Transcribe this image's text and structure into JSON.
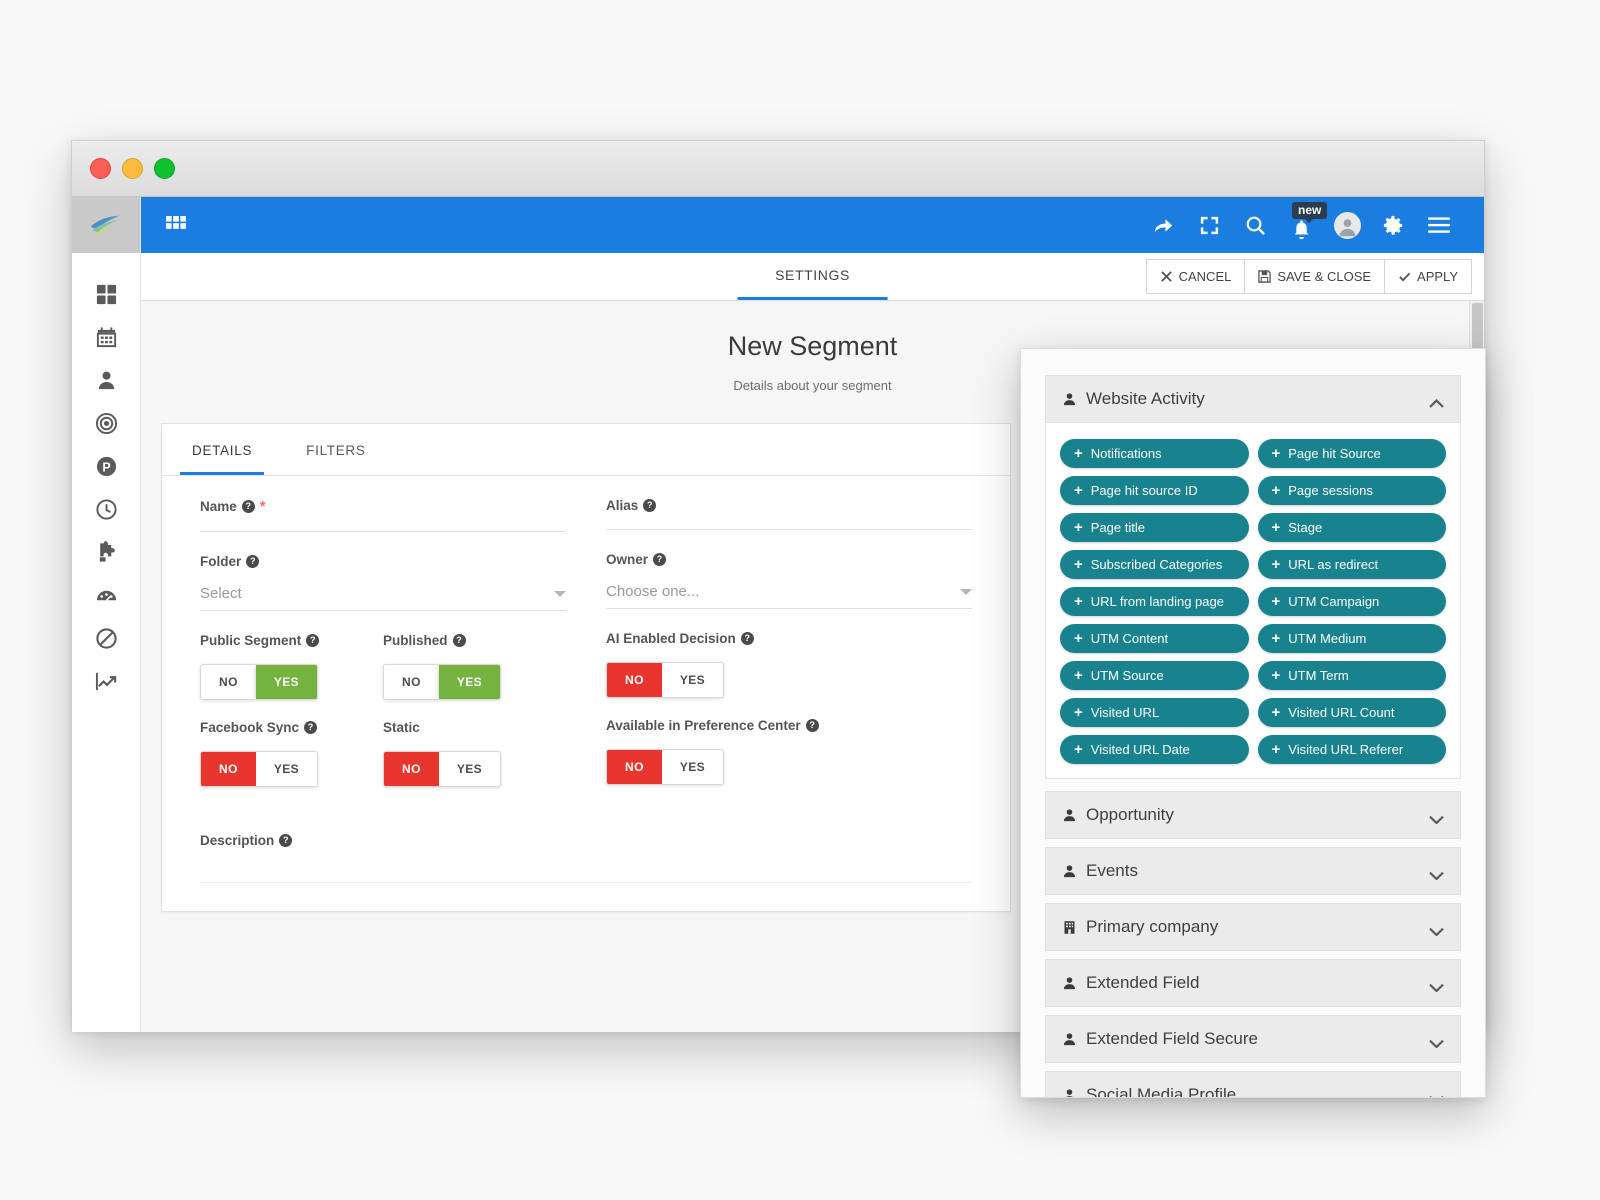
{
  "window": {
    "traffic_lights": [
      "close",
      "minimize",
      "maximize"
    ]
  },
  "topbar": {
    "grid_icon": "apps-grid-icon",
    "icons": [
      {
        "name": "share-icon",
        "label": "Share"
      },
      {
        "name": "fullscreen-icon",
        "label": "Fullscreen"
      },
      {
        "name": "search-icon",
        "label": "Search"
      },
      {
        "name": "notification-bell-icon",
        "label": "Notifications",
        "badge": "new"
      },
      {
        "name": "user-avatar-icon",
        "label": "Account"
      },
      {
        "name": "gear-icon",
        "label": "Settings"
      },
      {
        "name": "hamburger-menu-icon",
        "label": "Menu"
      }
    ],
    "badge_text": "new",
    "accent_color": "#1a7de0"
  },
  "settings_bar": {
    "tab_label": "SETTINGS",
    "cancel_label": "CANCEL",
    "save_close_label": "SAVE & CLOSE",
    "apply_label": "APPLY"
  },
  "sidebar": {
    "items": [
      {
        "name": "sidebar-item-dashboard",
        "icon": "dashboard-grid-icon"
      },
      {
        "name": "sidebar-item-calendar",
        "icon": "calendar-icon"
      },
      {
        "name": "sidebar-item-contacts",
        "icon": "person-icon"
      },
      {
        "name": "sidebar-item-segments",
        "icon": "bullseye-target-icon"
      },
      {
        "name": "sidebar-item-points",
        "icon": "points-p-icon"
      },
      {
        "name": "sidebar-item-history",
        "icon": "clock-icon"
      },
      {
        "name": "sidebar-item-plugins",
        "icon": "puzzle-piece-icon"
      },
      {
        "name": "sidebar-item-reports",
        "icon": "gauge-icon"
      },
      {
        "name": "sidebar-item-dnc",
        "icon": "ban-icon"
      },
      {
        "name": "sidebar-item-analytics",
        "icon": "trending-up-icon"
      }
    ]
  },
  "page": {
    "title": "New Segment",
    "subtitle": "Details about your segment"
  },
  "card": {
    "tabs": [
      {
        "label": "DETAILS",
        "active": true
      },
      {
        "label": "FILTERS",
        "active": false
      }
    ],
    "fields": {
      "name_label": "Name",
      "name_required": "*",
      "name_value": "",
      "alias_label": "Alias",
      "alias_value": "",
      "folder_label": "Folder",
      "folder_value": "Select",
      "owner_label": "Owner",
      "owner_value": "Choose one...",
      "description_label": "Description",
      "description_value": ""
    },
    "toggles": [
      {
        "label": "Public Segment",
        "no": "NO",
        "yes": "YES",
        "state": "yes",
        "has_help": true
      },
      {
        "label": "Published",
        "no": "NO",
        "yes": "YES",
        "state": "yes",
        "has_help": true
      },
      {
        "label": "AI Enabled Decision",
        "no": "NO",
        "yes": "YES",
        "state": "no",
        "has_help": true
      },
      {
        "label": "Facebook Sync",
        "no": "NO",
        "yes": "YES",
        "state": "no",
        "has_help": true
      },
      {
        "label": "Static",
        "no": "NO",
        "yes": "YES",
        "state": "no",
        "has_help": false
      },
      {
        "label": "Available in Preference Center",
        "no": "NO",
        "yes": "YES",
        "state": "no",
        "has_help": true
      }
    ],
    "colors": {
      "yes_on": "#74b340",
      "no_on": "#e8352e"
    }
  },
  "float_panel": {
    "expanded_section": {
      "title": "Website Activity",
      "icon": "person-icon",
      "chevron": "chevron-up-icon",
      "pills": [
        "Notifications",
        "Page hit Source",
        "Page hit source ID",
        "Page sessions",
        "Page title",
        "Stage",
        "Subscribed Categories",
        "URL as redirect",
        "URL from landing page",
        "UTM Campaign",
        "UTM Content",
        "UTM Medium",
        "UTM Source",
        "UTM Term",
        "Visited URL",
        "Visited URL Count",
        "Visited URL Date",
        "Visited URL Referer"
      ],
      "pill_color": "#18838f",
      "pill_prefix": "+"
    },
    "collapsed_sections": [
      {
        "title": "Opportunity",
        "icon": "person-icon",
        "chevron": "chevron-down-icon"
      },
      {
        "title": "Events",
        "icon": "person-icon",
        "chevron": "chevron-down-icon"
      },
      {
        "title": "Primary company",
        "icon": "building-icon",
        "chevron": "chevron-down-icon"
      },
      {
        "title": "Extended Field",
        "icon": "person-icon",
        "chevron": "chevron-down-icon"
      },
      {
        "title": "Extended Field Secure",
        "icon": "person-icon",
        "chevron": "chevron-down-icon"
      },
      {
        "title": "Social Media Profile",
        "icon": "person-icon",
        "chevron": "chevron-down-icon"
      }
    ]
  }
}
